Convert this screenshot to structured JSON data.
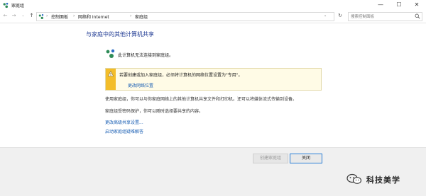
{
  "window": {
    "title": "家庭组",
    "icon": "homegroup-icon",
    "controls": {
      "minimize": "—",
      "maximize": "☐",
      "close": "✕"
    }
  },
  "address_bar": {
    "nav": {
      "back": "←",
      "forward": "→",
      "recent": "⌄",
      "up": "↑"
    },
    "breadcrumbs": [
      "控制面板",
      "网络和 Internet",
      "家庭组"
    ],
    "separator": "›",
    "dropdown": "⌄",
    "refresh": "↻",
    "search_placeholder": "搜索控制面板"
  },
  "main": {
    "title": "与家庭中的其他计算机共享",
    "status_text": "此计算机无法连接到家庭组。",
    "warning": {
      "text": "若要创建或加入家庭组，必须将计算机的网络位置设置为\"专用\"。",
      "link": "更改网络位置"
    },
    "description_1": "使用家庭组，你可以与你家庭网络上的其他计算机共享文件和打印机。还可以将媒体流式传输到设备。",
    "description_2": "家庭组受密码保护，你可以随时选择要共享的内容。",
    "links": [
      "更改高级共享设置...",
      "启动家庭组疑难解答"
    ]
  },
  "footer": {
    "create_button": "创建家庭组",
    "close_button": "关闭"
  },
  "watermark": {
    "text": "科技美学",
    "icon": "wechat-icon"
  },
  "colors": {
    "title_blue": "#1f3a93",
    "link_blue": "#1a5fb4",
    "warning_yellow": "#f3bd2a",
    "homegroup_green": "#2e8b57",
    "homegroup_blue": "#2a6cc4"
  }
}
